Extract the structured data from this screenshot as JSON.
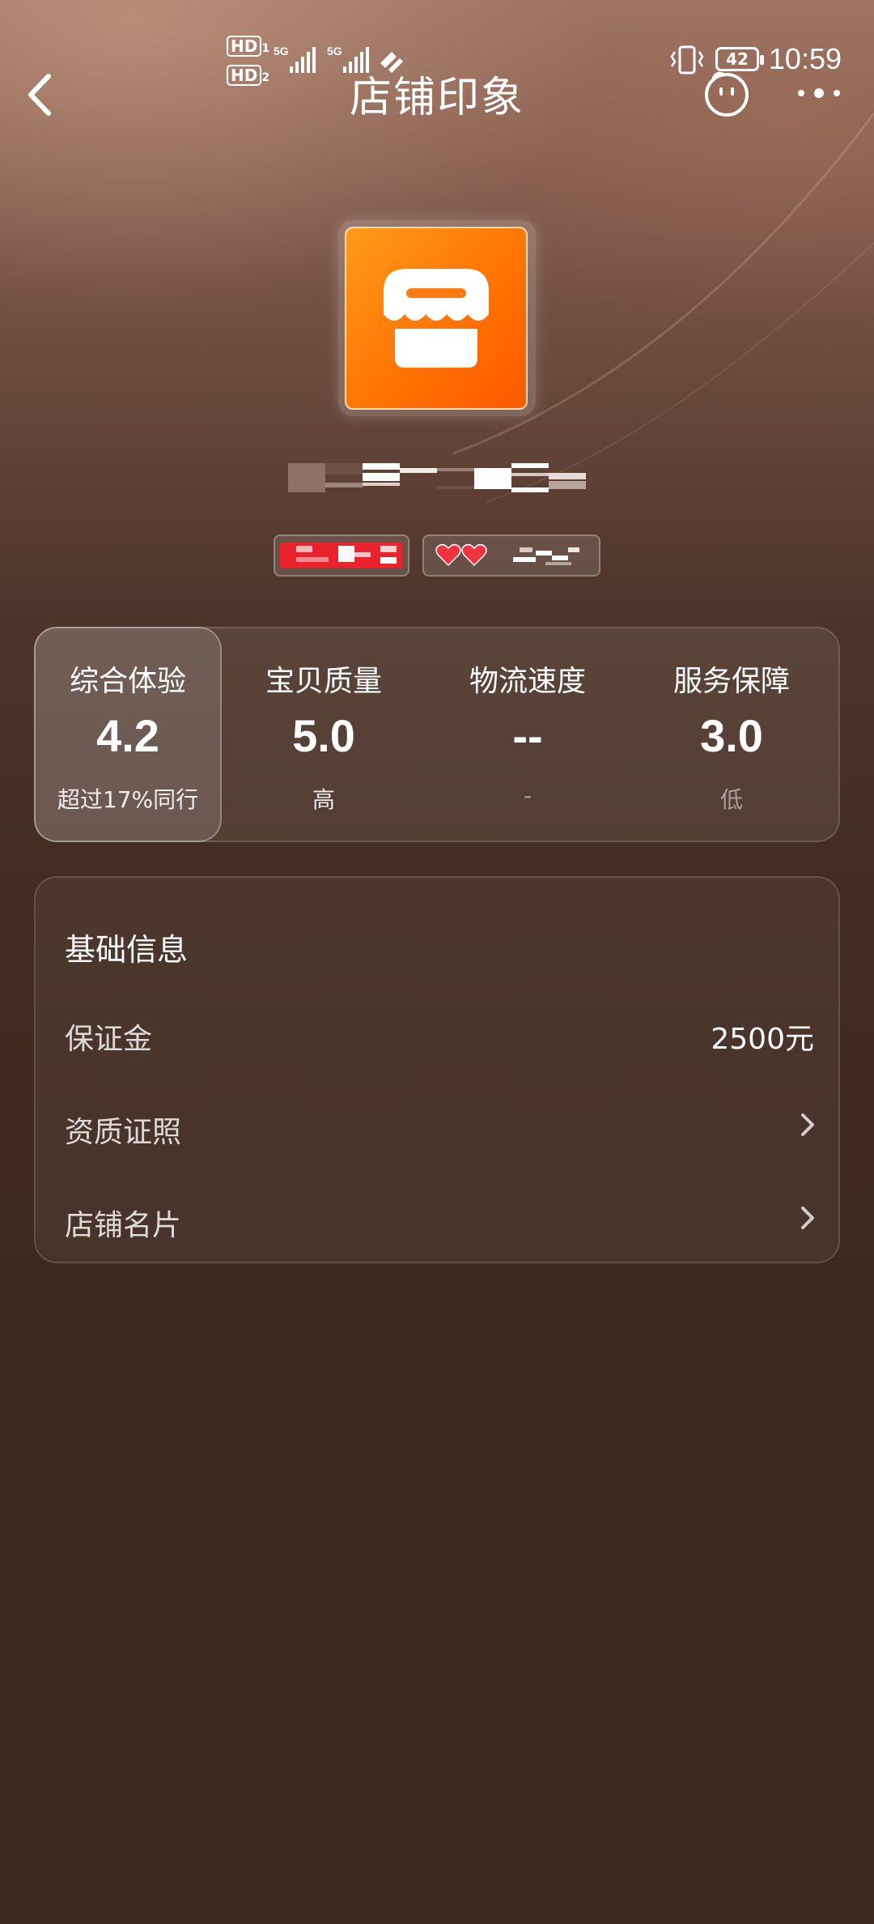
{
  "status_bar": {
    "hd1": "HD",
    "hd2": "HD",
    "sim1": "1",
    "sim2": "2",
    "net1": "5G",
    "net2": "5G",
    "battery": "42",
    "time": "10:59"
  },
  "nav": {
    "title": "店铺印象"
  },
  "ratings": [
    {
      "label": "综合体验",
      "score": "4.2",
      "sub": "超过17%同行"
    },
    {
      "label": "宝贝质量",
      "score": "5.0",
      "sub": "高"
    },
    {
      "label": "物流速度",
      "score": "--",
      "sub": "-"
    },
    {
      "label": "服务保障",
      "score": "3.0",
      "sub": "低"
    }
  ],
  "info": {
    "title": "基础信息",
    "rows": [
      {
        "label": "保证金",
        "value": "2500元"
      },
      {
        "label": "资质证照",
        "value": ""
      },
      {
        "label": "店铺名片",
        "value": ""
      }
    ]
  },
  "colors": {
    "logo_orange": "#ff6a00",
    "tag_red": "#e8232e",
    "heart_red": "#ef3340"
  },
  "icons": [
    "back-arrow-icon",
    "chat-face-icon",
    "more-dots-icon",
    "store-icon",
    "heart-icon",
    "chevron-right-icon"
  ]
}
